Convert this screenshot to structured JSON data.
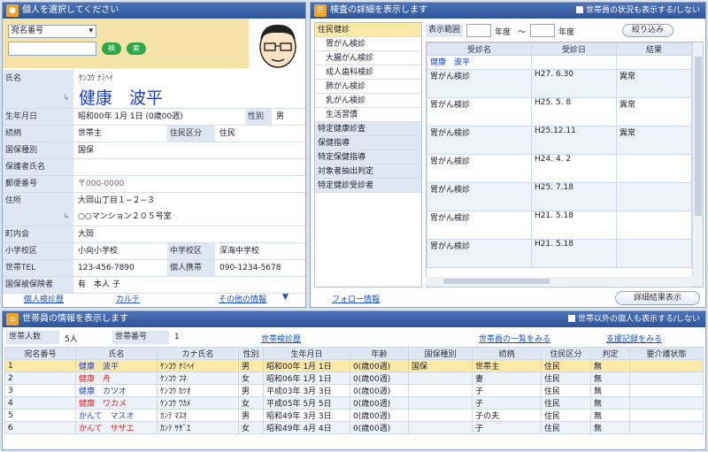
{
  "left_panel": {
    "title": "個人を選択してください",
    "search_select": "宛名番号",
    "search_value": "",
    "btn_a": "検",
    "btn_b": "索",
    "fields": [
      {
        "label": "氏名",
        "kana": "ｹﾝｺｳ ﾅﾐﾍｲ",
        "value": "健康　波平"
      },
      {
        "label": "生年月日",
        "value": "昭和00年 1月 1日 (0歳00週)",
        "extra_label": "性別",
        "extra_value": "男"
      },
      {
        "label": "続柄",
        "value": "世帯主",
        "extra_label": "住民区分",
        "extra_value": "住民"
      },
      {
        "label": "国保種別",
        "value": "国保"
      },
      {
        "label": "保護者氏名",
        "value": ""
      },
      {
        "label": "郵便番号",
        "value": "〒000-0000"
      },
      {
        "label": "住所",
        "value": "大岡山丁目１−２−３",
        "value2": "○○マンション２０５号室"
      },
      {
        "label": "町内会",
        "value": "大岡"
      },
      {
        "label": "小学校区",
        "value": "小向小学校",
        "extra_label": "中学校区",
        "extra_value": "深海中学校"
      },
      {
        "label": "世帯TEL",
        "value": "123-456-7890",
        "extra_label": "個人携帯",
        "extra_value": "090-1234-5678"
      },
      {
        "label": "国保被保険者",
        "value": "有　本人 子"
      }
    ],
    "links": [
      "個人検診歴",
      "カルテ",
      "その他の情報"
    ]
  },
  "right_panel": {
    "title": "検査の詳細を表示します",
    "checkbox_label": "世帯員の状況も表示する/しない",
    "menu": [
      {
        "label": "住民健診",
        "type": "cat",
        "selected": true
      },
      {
        "label": "胃がん検診",
        "type": "sub"
      },
      {
        "label": "大腸がん検診",
        "type": "sub"
      },
      {
        "label": "成人歯科検診",
        "type": "sub"
      },
      {
        "label": "肺がん検診",
        "type": "sub"
      },
      {
        "label": "乳がん検診",
        "type": "sub"
      },
      {
        "label": "生活習慣",
        "type": "sub"
      },
      {
        "label": "特定健康診査",
        "type": "cat"
      },
      {
        "label": "保健指導",
        "type": "cat"
      },
      {
        "label": "特定保健指導",
        "type": "cat"
      },
      {
        "label": "対象者抽出判定",
        "type": "cat"
      },
      {
        "label": "特定健診受診者",
        "type": "cat"
      }
    ],
    "range_label": "表示範囲",
    "year_from": "",
    "year_unit": "年度",
    "tilde": "〜",
    "year_to": "",
    "year_unit2": "年度",
    "narrow_btn": "絞り込み",
    "table_headers": [
      "受診名",
      "受診日",
      "結果"
    ],
    "table_rows": [
      {
        "name": "健康　波平",
        "date": "",
        "result": ""
      },
      {
        "name": "胃がん検診",
        "date": "H27. 6.30",
        "result": "異常"
      },
      {
        "name": "胃がん検診",
        "date": "H25. 5. 8",
        "result": "異常"
      },
      {
        "name": "胃がん検診",
        "date": "H25.12.11",
        "result": "異常"
      },
      {
        "name": "胃がん検診",
        "date": "H24. 4. 2",
        "result": ""
      },
      {
        "name": "胃がん検診",
        "date": "H25. 7.18",
        "result": ""
      },
      {
        "name": "胃がん検診",
        "date": "H21. 5.18",
        "result": ""
      },
      {
        "name": "胃がん検診",
        "date": "H21. 5.18",
        "result": ""
      }
    ],
    "followup_link": "フォロー情報",
    "detail_btn": "詳細結果表示"
  },
  "bottom_panel": {
    "title": "世帯員の情報を表示します",
    "checkbox_label": "世帯以外の個人も表示する/しない",
    "count_label": "世帯人数",
    "count_value": "5",
    "count_unit": "5人",
    "num_label": "世帯番号",
    "num_value": "1",
    "links": [
      "世帯検診歴",
      "世帯員の一覧をみる",
      "支援記録をみる"
    ],
    "headers": [
      "宛名番号",
      "氏名",
      "カナ氏名",
      "性別",
      "生年月日",
      "年齢",
      "国保種別",
      "続柄",
      "住民区分",
      "判定",
      "要介護状態"
    ],
    "rows": [
      {
        "no": "1",
        "name": "健康　波平",
        "kana": "ｹﾝｺｳ ﾅﾐﾍｲ",
        "sex": "男",
        "birth": "昭和00年 1月 1日",
        "age": "0(歳00週)",
        "kokuho": "国保",
        "zoku": "世帯主",
        "ku": "住民",
        "han": "無",
        "kaigo": "",
        "name_color": "blue",
        "highlight": true
      },
      {
        "no": "2",
        "name": "健康　舟",
        "kana": "ｹﾝｺｳ ﾌﾈ",
        "sex": "女",
        "birth": "昭和06年 1月 1日",
        "age": "0(歳00週)",
        "kokuho": "",
        "zoku": "妻",
        "ku": "住民",
        "han": "無",
        "kaigo": "",
        "name_color": "red",
        "highlight": false
      },
      {
        "no": "3",
        "name": "健康　カツオ",
        "kana": "ｹﾝｺｳ ｶﾂｵ",
        "sex": "男",
        "birth": "平成03年 3月 3日",
        "age": "0(歳00週)",
        "kokuho": "",
        "zoku": "子",
        "ku": "住民",
        "han": "無",
        "kaigo": "",
        "name_color": "blue",
        "highlight": false
      },
      {
        "no": "4",
        "name": "健康　ワカメ",
        "kana": "ｹﾝｺｳ ﾜｶﾒ",
        "sex": "女",
        "birth": "平成05年 5月 5日",
        "age": "0(歳00週)",
        "kokuho": "",
        "zoku": "子",
        "ku": "住民",
        "han": "無",
        "kaigo": "",
        "name_color": "red",
        "highlight": false
      },
      {
        "no": "5",
        "name": "かんて　マスオ",
        "kana": "ｶﾝﾃ ﾏｽｵ",
        "sex": "男",
        "birth": "昭和49年 3月 3日",
        "age": "0(歳00週)",
        "kokuho": "",
        "zoku": "子の夫",
        "ku": "住民",
        "han": "無",
        "kaigo": "",
        "name_color": "blue",
        "highlight": false
      },
      {
        "no": "6",
        "name": "かんて　サザエ",
        "kana": "ｶﾝﾃ ｻｻﾞｴ",
        "sex": "女",
        "birth": "昭和49年 4月 4日",
        "age": "0(歳00週)",
        "kokuho": "",
        "zoku": "子",
        "ku": "住民",
        "han": "無",
        "kaigo": "",
        "name_color": "red",
        "highlight": false
      }
    ]
  }
}
